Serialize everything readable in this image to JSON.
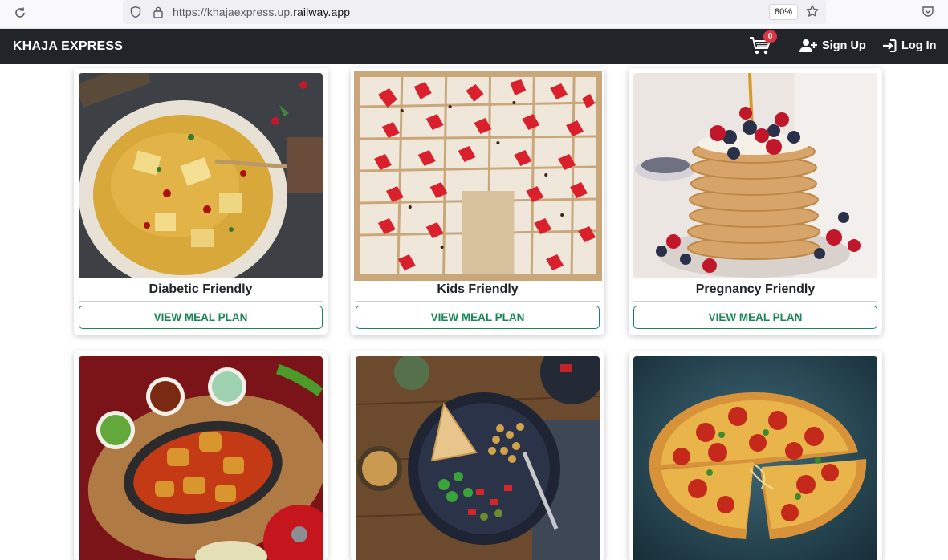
{
  "browser": {
    "url_prefix": "https://khajaexpress.up.",
    "url_domain": "railway.app",
    "zoom": "80%"
  },
  "navbar": {
    "brand": "KHAJA EXPRESS",
    "cart_count": "0",
    "signup_label": "Sign Up",
    "login_label": "Log In"
  },
  "colors": {
    "navbar_bg": "#212529",
    "accent_green": "#198754",
    "badge_red": "#dc3545"
  },
  "meal_plans": [
    {
      "title": "Diabetic Friendly",
      "button": "VIEW MEAL PLAN",
      "image": "paneer-biryani-image"
    },
    {
      "title": "Kids Friendly",
      "button": "VIEW MEAL PLAN",
      "image": "strawberry-yogurt-bark-image"
    },
    {
      "title": "Pregnancy Friendly",
      "button": "VIEW MEAL PLAN",
      "image": "berry-pancake-stack-image"
    },
    {
      "title": "",
      "button": "",
      "image": "chicken-curry-image"
    },
    {
      "title": "",
      "button": "",
      "image": "chickpea-salad-bowl-image"
    },
    {
      "title": "",
      "button": "",
      "image": "pepperoni-pizza-image"
    }
  ]
}
